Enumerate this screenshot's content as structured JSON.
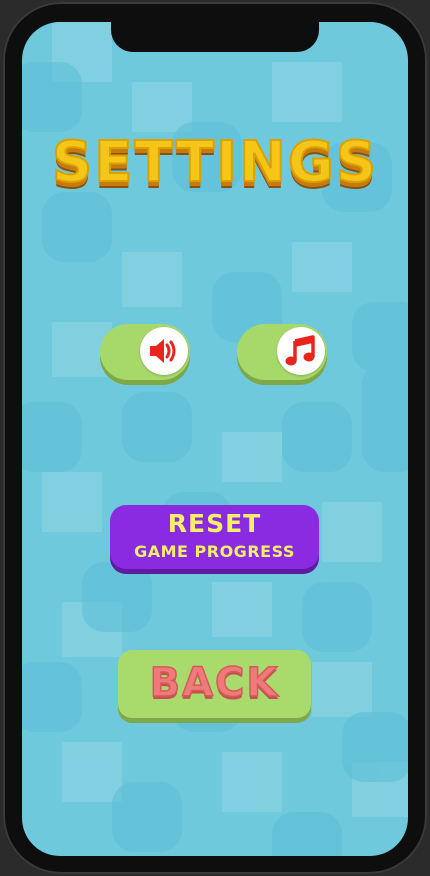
{
  "screen": {
    "title": "SETTINGS",
    "background_color": "#6fc9dd",
    "accent_color": "#f5c518"
  },
  "toggles": {
    "sound": {
      "icon": "speaker-icon",
      "state": "on",
      "color": "#a6d86a"
    },
    "music": {
      "icon": "music-note-icon",
      "state": "on",
      "color": "#a6d86a"
    }
  },
  "reset": {
    "line1": "RESET",
    "line2": "GAME PROGRESS",
    "color": "#8a2be2",
    "text_color": "#f3ef6b"
  },
  "back": {
    "label": "BACK",
    "color": "#a8da6c",
    "text_color": "#f07a7a"
  }
}
